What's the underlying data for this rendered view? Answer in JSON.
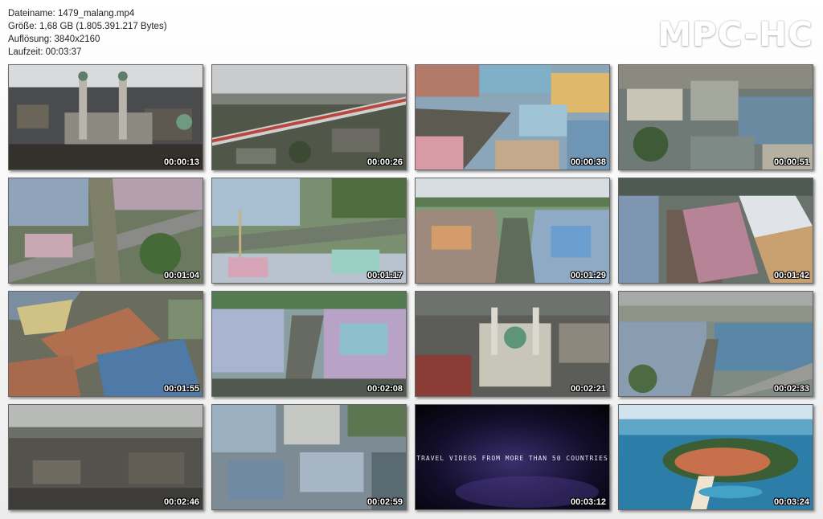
{
  "file_info": {
    "filename": "Dateiname: 1479_malang.mp4",
    "size": "Größe: 1,68 GB (1.805.391.217 Bytes)",
    "resolution": "Auflösung: 3840x2160",
    "duration": "Laufzeit: 00:03:37"
  },
  "brand": "MPC-HC",
  "thumbnails": [
    {
      "time": "00:00:13"
    },
    {
      "time": "00:00:26"
    },
    {
      "time": "00:00:38"
    },
    {
      "time": "00:00:51"
    },
    {
      "time": "00:01:04"
    },
    {
      "time": "00:01:17"
    },
    {
      "time": "00:01:29"
    },
    {
      "time": "00:01:42"
    },
    {
      "time": "00:01:55"
    },
    {
      "time": "00:02:08"
    },
    {
      "time": "00:02:21"
    },
    {
      "time": "00:02:33"
    },
    {
      "time": "00:02:46"
    },
    {
      "time": "00:02:59"
    },
    {
      "time": "00:03:12",
      "caption": "TRAVEL VIDEOS FROM MORE THAN 50 COUNTRIES"
    },
    {
      "time": "00:03:24"
    }
  ]
}
